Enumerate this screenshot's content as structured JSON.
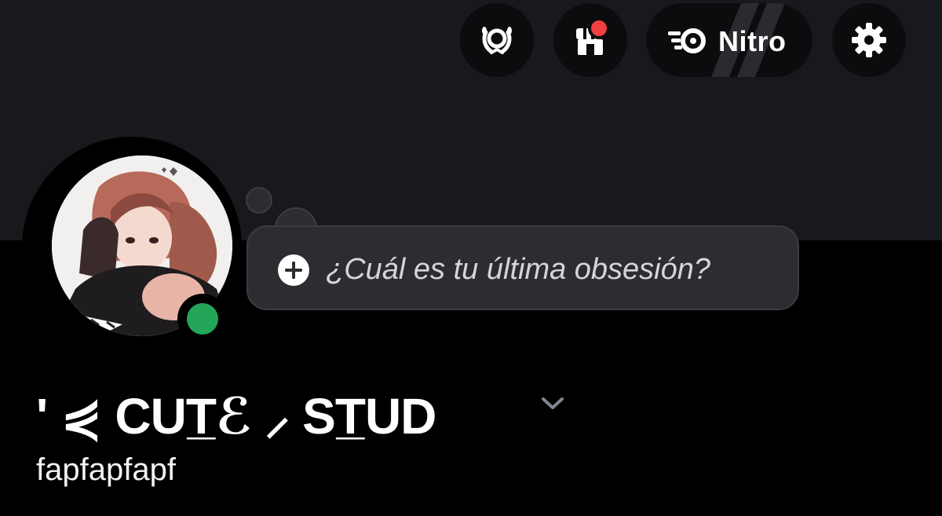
{
  "header": {
    "quests_icon": "laurel-wreath-icon",
    "shop_icon": "shop-icon",
    "shop_has_notification": true,
    "nitro_label": "Nitro",
    "nitro_icon": "nitro-icon",
    "settings_icon": "gear-icon"
  },
  "profile": {
    "avatar_icon": "anime-avatar",
    "status": "online",
    "status_color": "#23a55a",
    "custom_status_placeholder": "¿Cuál es tu última obsesión?",
    "display_name": "'  ⋞ CUT̲ℰ  ⸝ ST̲UD",
    "username": "fapfapfapf"
  },
  "colors": {
    "banner": "#18191c",
    "background": "#000000",
    "bubble": "#2b2d31",
    "notification": "#f23f42"
  }
}
